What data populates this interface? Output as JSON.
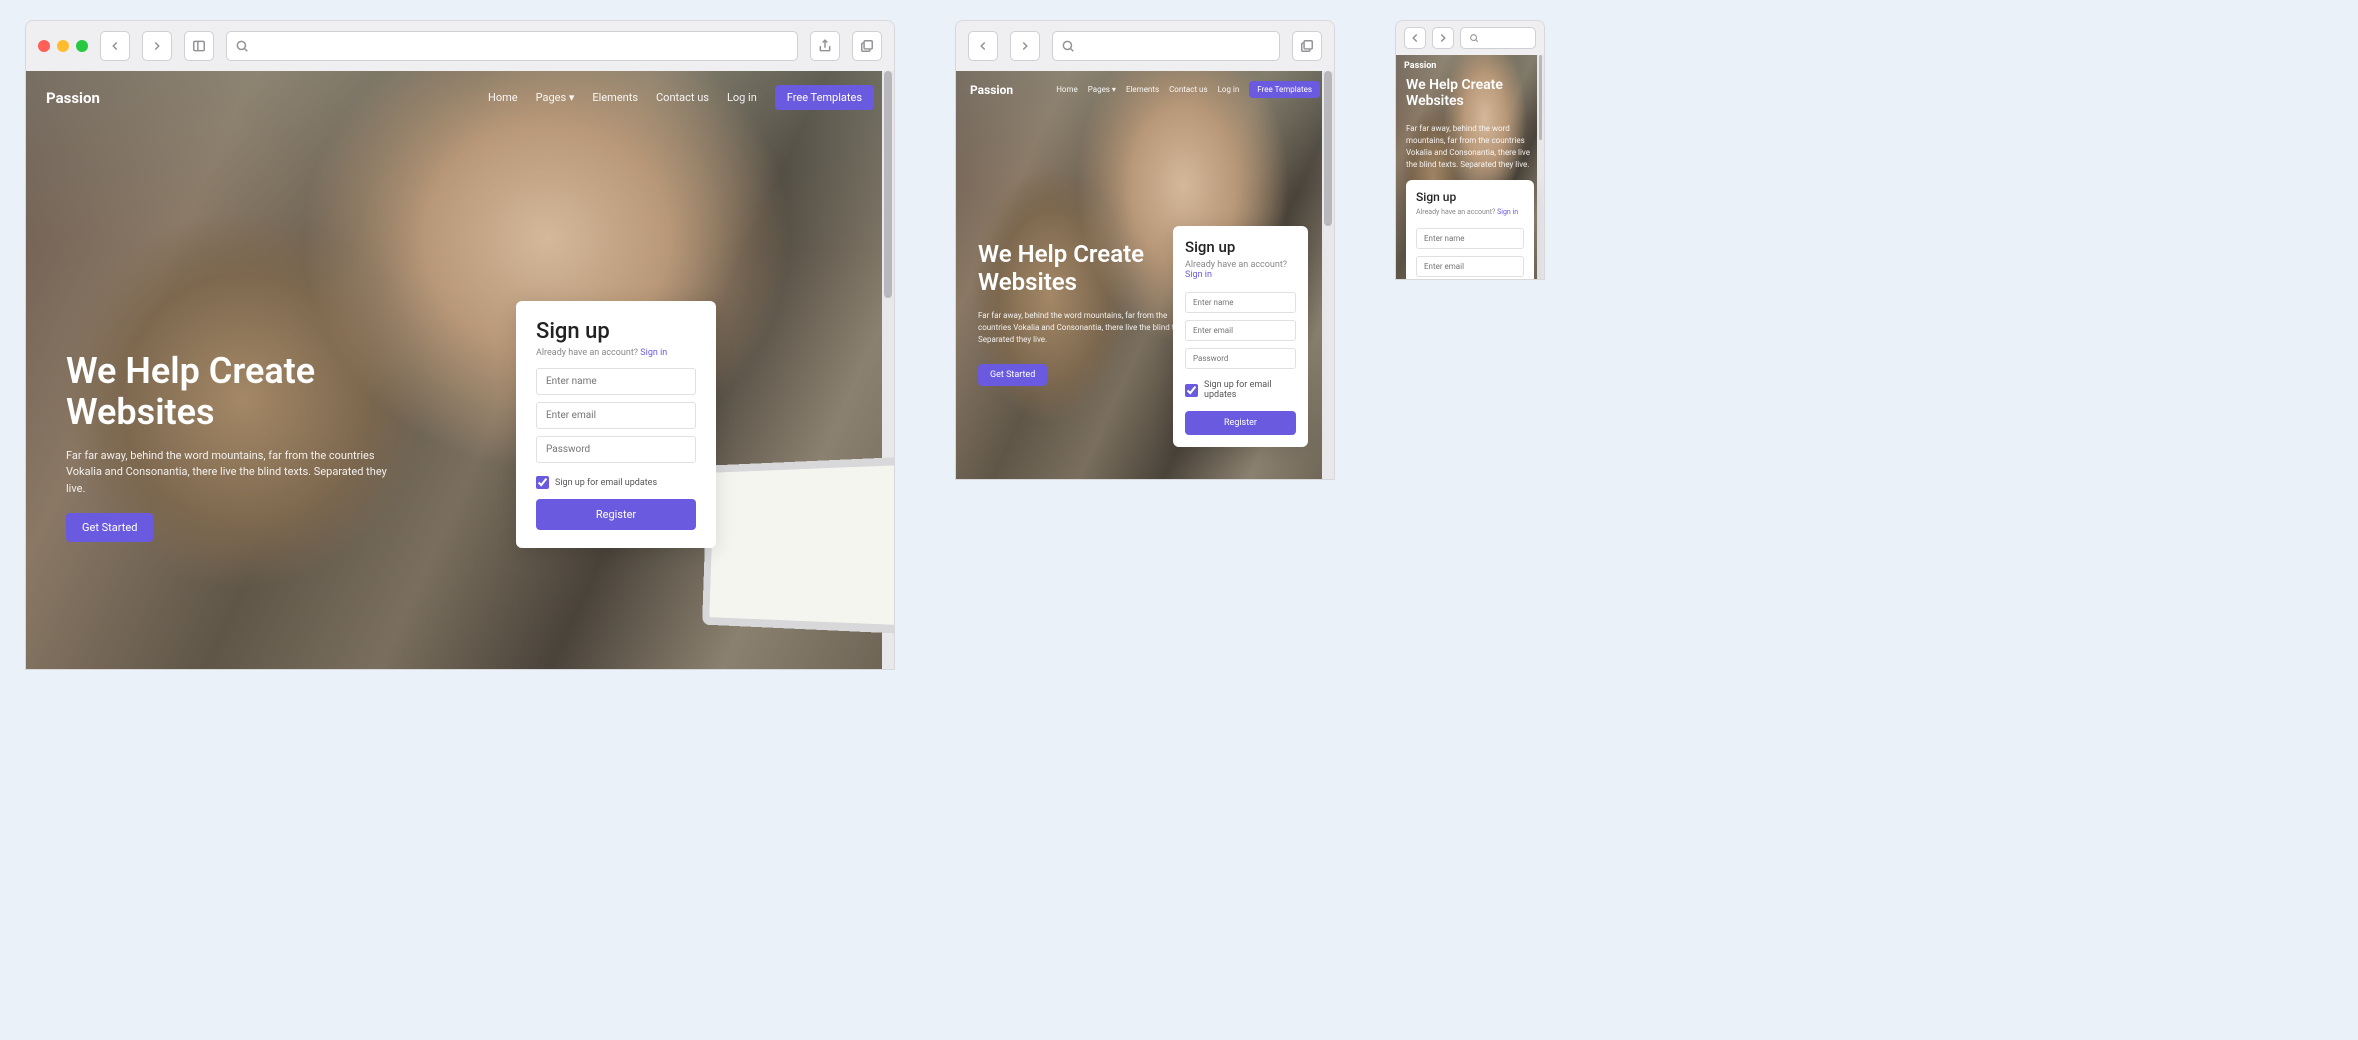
{
  "site": {
    "logo": "Passion",
    "nav": {
      "home": "Home",
      "pages": "Pages",
      "elements": "Elements",
      "contact": "Contact us",
      "login": "Log in",
      "free_templates": "Free Templates"
    }
  },
  "hero": {
    "title": "We Help Create Websites",
    "subtitle": "Far far away, behind the word mountains, far from the countries Vokalia and Consonantia, there live the blind texts. Separated they live.",
    "cta": "Get Started"
  },
  "signup": {
    "title": "Sign up",
    "already_text": "Already have an account?",
    "signin_link": "Sign in",
    "name_placeholder": "Enter name",
    "email_placeholder": "Enter email",
    "password_placeholder": "Password",
    "checkbox_label": "Sign up for email updates",
    "register": "Register"
  },
  "colors": {
    "accent": "#6a5ae0"
  }
}
